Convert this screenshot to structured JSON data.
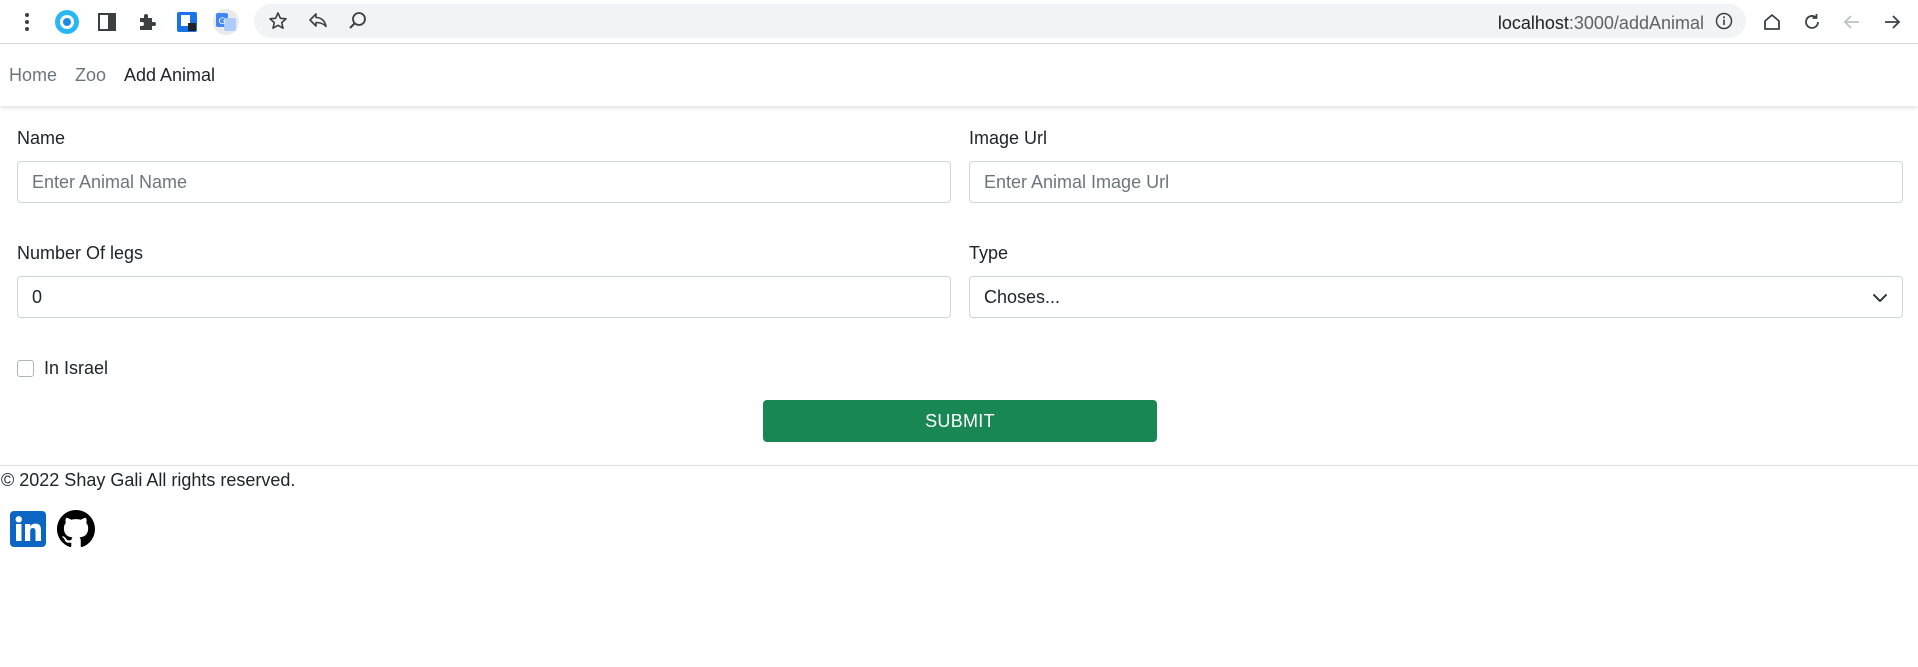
{
  "browser": {
    "url_host": "localhost",
    "url_path": ":3000/addAnimal",
    "icons": [
      "menu-dots-icon",
      "extension-circle-icon",
      "side-panel-icon",
      "puzzle-icon",
      "bookmark-app-icon",
      "translate-icon",
      "star-icon",
      "share-icon",
      "zoom-icon",
      "site-info-icon",
      "home-icon",
      "reload-icon",
      "back-icon",
      "forward-icon"
    ]
  },
  "navbar": {
    "links": [
      {
        "label": "Home"
      },
      {
        "label": "Zoo"
      },
      {
        "label": "Add Animal"
      }
    ]
  },
  "form": {
    "name": {
      "label": "Name",
      "placeholder": "Enter Animal Name",
      "value": ""
    },
    "image_url": {
      "label": "Image Url",
      "placeholder": "Enter Animal Image Url",
      "value": ""
    },
    "legs": {
      "label": "Number Of legs",
      "value": "0"
    },
    "type": {
      "label": "Type",
      "selected": "Choses..."
    },
    "in_israel": {
      "label": "In Israel",
      "checked": false
    },
    "submit_label": "SUBMIT"
  },
  "footer": {
    "copyright": "© 2022 Shay Gali All rights reserved.",
    "social": [
      "linkedin-icon",
      "github-icon"
    ]
  },
  "colors": {
    "submit_bg": "#198754",
    "linkedin": "#0a66c2",
    "github": "#000000"
  }
}
